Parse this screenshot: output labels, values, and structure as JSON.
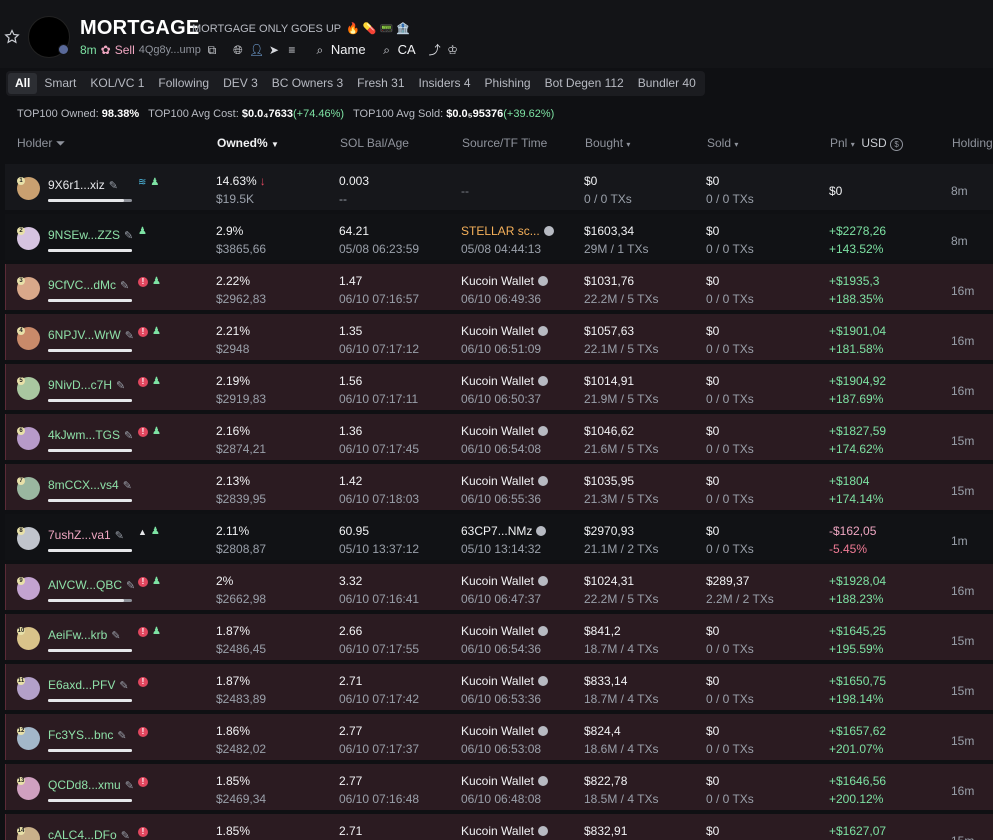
{
  "token": {
    "name": "MORTGAGE",
    "subtitle": "MORTGAGE ONLY GOES UP",
    "subtitle_emojis": "🔥 💊 📟 🏦",
    "age": "8m",
    "sell_label": "Sell",
    "address": "4Qg8y...ump",
    "search_name": "Name",
    "search_ca": "CA"
  },
  "tabs": [
    "All",
    "Smart",
    "KOL/VC 1",
    "Following",
    "DEV 3",
    "BC Owners 3",
    "Fresh 31",
    "Insiders 4",
    "Phishing",
    "Bot Degen 112",
    "Bundler 40"
  ],
  "stats": {
    "owned_label": "TOP100 Owned:",
    "owned_value": "98.38%",
    "avg_cost_label": "TOP100 Avg Cost:",
    "avg_cost_value": "$0.0₄7633",
    "avg_cost_change": "(+74.46%)",
    "avg_sold_label": "TOP100 Avg Sold:",
    "avg_sold_value": "$0.0₅95376",
    "avg_sold_change": "(+39.62%)"
  },
  "columns": {
    "holder": "Holder",
    "owned": "Owned%",
    "sol": "SOL Bal/Age",
    "source": "Source/TF Time",
    "bought": "Bought",
    "sold": "Sold",
    "pnl": "Pnl",
    "usd": "USD",
    "holding": "Holding"
  },
  "holders": [
    {
      "rank": "1",
      "name": "9X6r1...xiz",
      "name_color": "white",
      "style": "plain",
      "tags": [
        "fish",
        "user"
      ],
      "owned": "14.63%",
      "down": "↓",
      "owned_usd": "$19.5K",
      "sol": "0.003",
      "age": "--",
      "source": "--",
      "tf": "",
      "bought": "$0",
      "bought_txs": "0 / 0 TXs",
      "sold": "$0",
      "sold_txs": "0 / 0 TXs",
      "pnl": "$0",
      "pnl_pct": "",
      "hold": "8m",
      "bar": 0.1,
      "av": "#c9a070"
    },
    {
      "rank": "2",
      "name": "9NSEw...ZZS",
      "name_color": "green",
      "style": "dark",
      "tags": [
        "user"
      ],
      "owned": "2.9%",
      "down": "",
      "owned_usd": "$3865,66",
      "sol": "64.21",
      "age": "05/08 06:23:59",
      "source": "STELLAR sc...",
      "tf": "05/08 04:44:13",
      "bought": "$1603,34",
      "bought_txs": "29M / 1 TXs",
      "sold": "$0",
      "sold_txs": "0 / 0 TXs",
      "pnl": "+$2278,26",
      "pnl_pct": "+143.52%",
      "hold": "8m",
      "bar": 0.0,
      "av": "#d6c3e0"
    },
    {
      "rank": "3",
      "name": "9CfVC...dMc",
      "name_color": "green",
      "style": "red",
      "tags": [
        "red",
        "user"
      ],
      "owned": "2.22%",
      "down": "",
      "owned_usd": "$2962,83",
      "sol": "1.47",
      "age": "06/10 07:16:57",
      "source": "Kucoin Wallet",
      "tf": "06/10 06:49:36",
      "bought": "$1031,76",
      "bought_txs": "22.2M / 5 TXs",
      "sold": "$0",
      "sold_txs": "0 / 0 TXs",
      "pnl": "+$1935,3",
      "pnl_pct": "+188.35%",
      "hold": "16m",
      "bar": 0.0,
      "av": "#d9a88a"
    },
    {
      "rank": "4",
      "name": "6NPJV...WrW",
      "name_color": "green",
      "style": "red",
      "tags": [
        "red",
        "user"
      ],
      "owned": "2.21%",
      "down": "",
      "owned_usd": "$2948",
      "sol": "1.35",
      "age": "06/10 07:17:12",
      "source": "Kucoin Wallet",
      "tf": "06/10 06:51:09",
      "bought": "$1057,63",
      "bought_txs": "22.1M / 5 TXs",
      "sold": "$0",
      "sold_txs": "0 / 0 TXs",
      "pnl": "+$1901,04",
      "pnl_pct": "+181.58%",
      "hold": "16m",
      "bar": 0.0,
      "av": "#c98a6a"
    },
    {
      "rank": "5",
      "name": "9NivD...c7H",
      "name_color": "green",
      "style": "red",
      "tags": [
        "red",
        "user"
      ],
      "owned": "2.19%",
      "down": "",
      "owned_usd": "$2919,83",
      "sol": "1.56",
      "age": "06/10 07:17:11",
      "source": "Kucoin Wallet",
      "tf": "06/10 06:50:37",
      "bought": "$1014,91",
      "bought_txs": "21.9M / 5 TXs",
      "sold": "$0",
      "sold_txs": "0 / 0 TXs",
      "pnl": "+$1904,92",
      "pnl_pct": "+187.69%",
      "hold": "16m",
      "bar": 0.0,
      "av": "#a9c7a0"
    },
    {
      "rank": "6",
      "name": "4kJwm...TGS",
      "name_color": "green",
      "style": "red",
      "tags": [
        "red",
        "user"
      ],
      "owned": "2.16%",
      "down": "",
      "owned_usd": "$2874,21",
      "sol": "1.36",
      "age": "06/10 07:17:45",
      "source": "Kucoin Wallet",
      "tf": "06/10 06:54:08",
      "bought": "$1046,62",
      "bought_txs": "21.6M / 5 TXs",
      "sold": "$0",
      "sold_txs": "0 / 0 TXs",
      "pnl": "+$1827,59",
      "pnl_pct": "+174.62%",
      "hold": "15m",
      "bar": 0.0,
      "av": "#b79ac9"
    },
    {
      "rank": "7",
      "name": "8mCCX...vs4",
      "name_color": "green",
      "style": "red",
      "tags": [],
      "owned": "2.13%",
      "down": "",
      "owned_usd": "$2839,95",
      "sol": "1.42",
      "age": "06/10 07:18:03",
      "source": "Kucoin Wallet",
      "tf": "06/10 06:55:36",
      "bought": "$1035,95",
      "bought_txs": "21.3M / 5 TXs",
      "sold": "$0",
      "sold_txs": "0 / 0 TXs",
      "pnl": "+$1804",
      "pnl_pct": "+174.14%",
      "hold": "15m",
      "bar": 0.0,
      "av": "#9ab7a0"
    },
    {
      "rank": "8",
      "name": "7ushZ...va1",
      "name_color": "pink",
      "style": "dark",
      "tags": [
        "tri",
        "user"
      ],
      "owned": "2.11%",
      "down": "",
      "owned_usd": "$2808,87",
      "sol": "60.95",
      "age": "05/10 13:37:12",
      "source": "63CP7...NMz",
      "tf": "05/10 13:14:32",
      "bought": "$2970,93",
      "bought_txs": "21.1M / 2 TXs",
      "sold": "$0",
      "sold_txs": "0 / 0 TXs",
      "pnl": "-$162,05",
      "pnl_pct": "-5.45%",
      "hold": "1m",
      "bar": 0.0,
      "av": "#c0c4cc"
    },
    {
      "rank": "9",
      "name": "AlVCW...QBC",
      "name_color": "green",
      "style": "red",
      "tags": [
        "red",
        "user"
      ],
      "owned": "2%",
      "down": "",
      "owned_usd": "$2662,98",
      "sol": "3.32",
      "age": "06/10 07:16:41",
      "source": "Kucoin Wallet",
      "tf": "06/10 06:47:37",
      "bought": "$1024,31",
      "bought_txs": "22.2M / 5 TXs",
      "sold": "$289,37",
      "sold_txs": "2.2M / 2 TXs",
      "pnl": "+$1928,04",
      "pnl_pct": "+188.23%",
      "hold": "16m",
      "bar": 0.1,
      "av": "#c3a3d0"
    },
    {
      "rank": "10",
      "name": "AeiFw...krb",
      "name_color": "green",
      "style": "red",
      "tags": [
        "red",
        "user"
      ],
      "owned": "1.87%",
      "down": "",
      "owned_usd": "$2486,45",
      "sol": "2.66",
      "age": "06/10 07:17:55",
      "source": "Kucoin Wallet",
      "tf": "06/10 06:54:36",
      "bought": "$841,2",
      "bought_txs": "18.7M / 4 TXs",
      "sold": "$0",
      "sold_txs": "0 / 0 TXs",
      "pnl": "+$1645,25",
      "pnl_pct": "+195.59%",
      "hold": "15m",
      "bar": 0.0,
      "av": "#d9c38a"
    },
    {
      "rank": "11",
      "name": "E6axd...PFV",
      "name_color": "green",
      "style": "red",
      "tags": [
        "red"
      ],
      "owned": "1.87%",
      "down": "",
      "owned_usd": "$2483,89",
      "sol": "2.71",
      "age": "06/10 07:17:42",
      "source": "Kucoin Wallet",
      "tf": "06/10 06:53:36",
      "bought": "$833,14",
      "bought_txs": "18.7M / 4 TXs",
      "sold": "$0",
      "sold_txs": "0 / 0 TXs",
      "pnl": "+$1650,75",
      "pnl_pct": "+198.14%",
      "hold": "15m",
      "bar": 0.0,
      "av": "#b3a0c9"
    },
    {
      "rank": "12",
      "name": "Fc3YS...bnc",
      "name_color": "green",
      "style": "red",
      "tags": [
        "red"
      ],
      "owned": "1.86%",
      "down": "",
      "owned_usd": "$2482,02",
      "sol": "2.77",
      "age": "06/10 07:17:37",
      "source": "Kucoin Wallet",
      "tf": "06/10 06:53:08",
      "bought": "$824,4",
      "bought_txs": "18.6M / 4 TXs",
      "sold": "$0",
      "sold_txs": "0 / 0 TXs",
      "pnl": "+$1657,62",
      "pnl_pct": "+201.07%",
      "hold": "15m",
      "bar": 0.0,
      "av": "#a3b7c9"
    },
    {
      "rank": "13",
      "name": "QCDd8...xmu",
      "name_color": "green",
      "style": "red",
      "tags": [
        "red"
      ],
      "owned": "1.85%",
      "down": "",
      "owned_usd": "$2469,34",
      "sol": "2.77",
      "age": "06/10 07:16:48",
      "source": "Kucoin Wallet",
      "tf": "06/10 06:48:08",
      "bought": "$822,78",
      "bought_txs": "18.5M / 4 TXs",
      "sold": "$0",
      "sold_txs": "0 / 0 TXs",
      "pnl": "+$1646,56",
      "pnl_pct": "+200.12%",
      "hold": "16m",
      "bar": 0.0,
      "av": "#d0a0c0"
    },
    {
      "rank": "14",
      "name": "cALC4...DFo",
      "name_color": "green",
      "style": "red",
      "tags": [
        "red"
      ],
      "owned": "1.85%",
      "down": "",
      "owned_usd": "",
      "sol": "2.71",
      "age": "",
      "source": "Kucoin Wallet",
      "tf": "",
      "bought": "$832,91",
      "bought_txs": "",
      "sold": "$0",
      "sold_txs": "",
      "pnl": "+$1627,07",
      "pnl_pct": "",
      "hold": "15m",
      "bar": 0.0,
      "av": "#c9b08a"
    }
  ]
}
